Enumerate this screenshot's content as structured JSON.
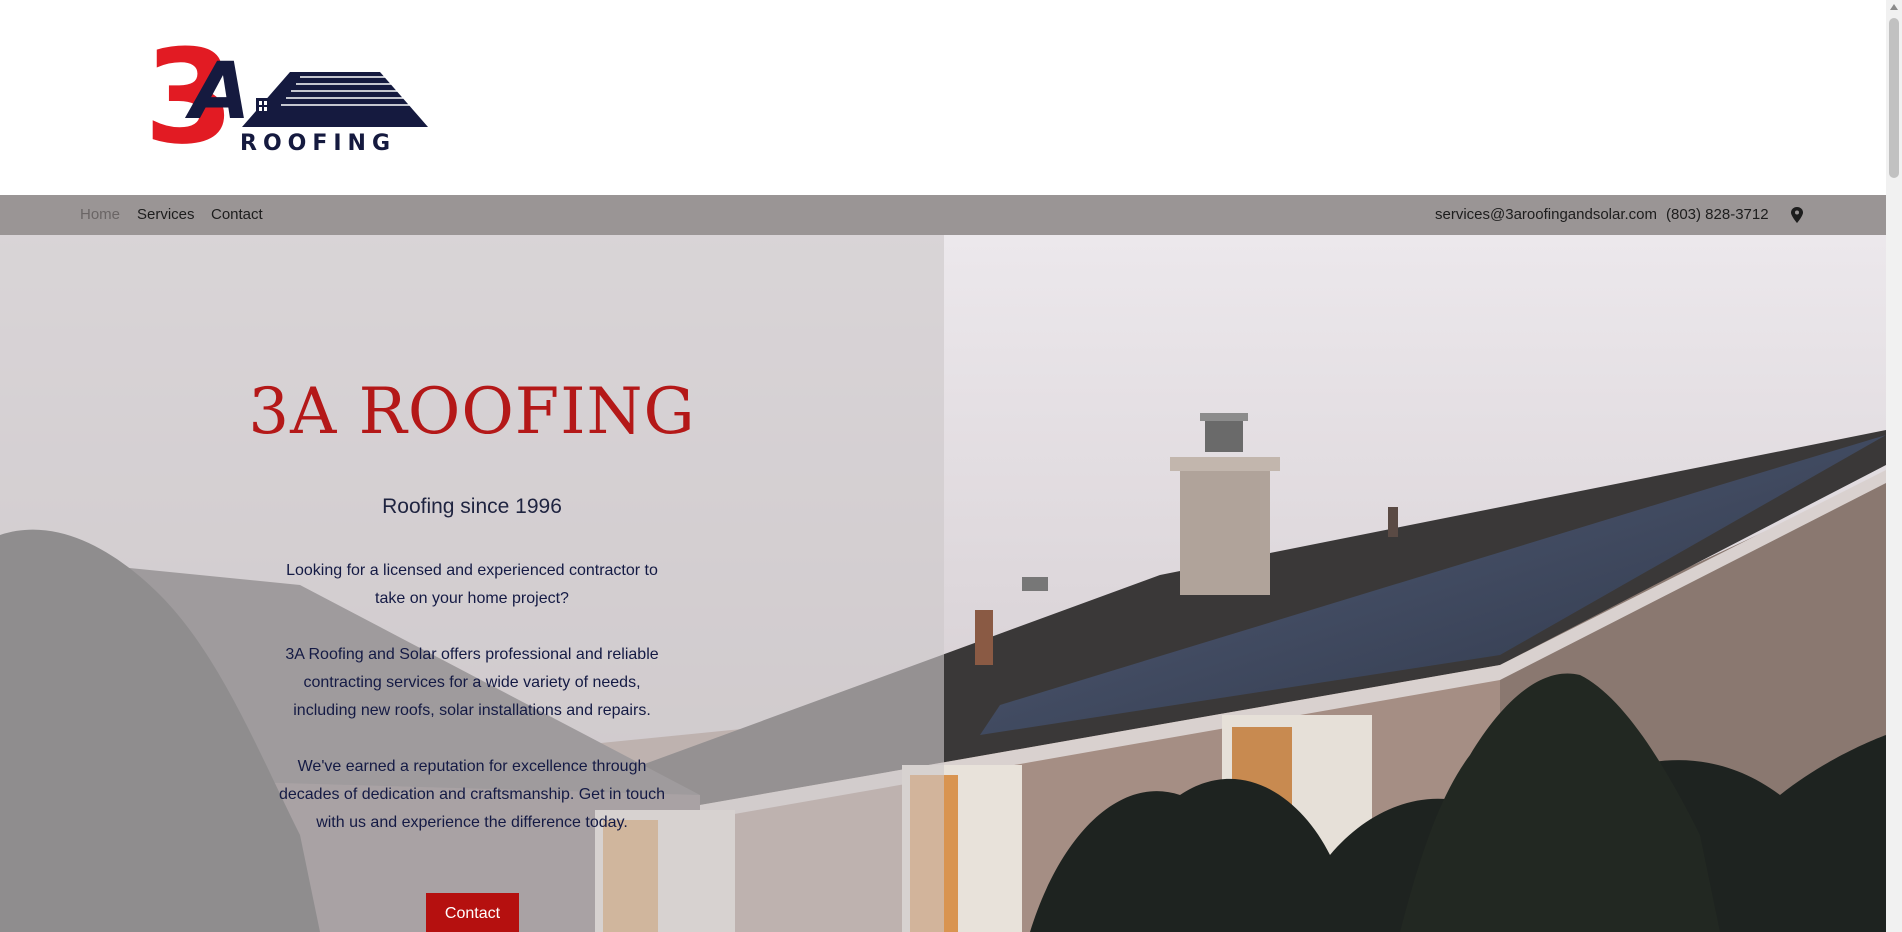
{
  "brand": {
    "logo_number": "3",
    "logo_letter": "A",
    "logo_text": "ROOFING",
    "logo_red": "#e21b23",
    "logo_navy": "#151a3f"
  },
  "nav": {
    "items": [
      {
        "label": "Home",
        "active": true
      },
      {
        "label": "Services",
        "active": false
      },
      {
        "label": "Contact",
        "active": false
      }
    ],
    "email": "services@3aroofingandsolar.com",
    "phone": "(803) 828-3712",
    "location_icon": "map-pin-icon"
  },
  "hero": {
    "title": "3A ROOFING",
    "subtitle": "Roofing since 1996",
    "paragraph1": "Looking for a licensed and experienced contractor to take on your home project?",
    "paragraph2": "3A Roofing and Solar offers professional and reliable contracting services for a wide variety of needs, including new roofs, solar installations and repairs.",
    "paragraph3": "We've earned a reputation for excellence through decades of dedication and craftsmanship. Get in touch with us and experience the difference today.",
    "button_label": "Contact",
    "title_color": "#b41818",
    "button_color": "#b5100f"
  }
}
